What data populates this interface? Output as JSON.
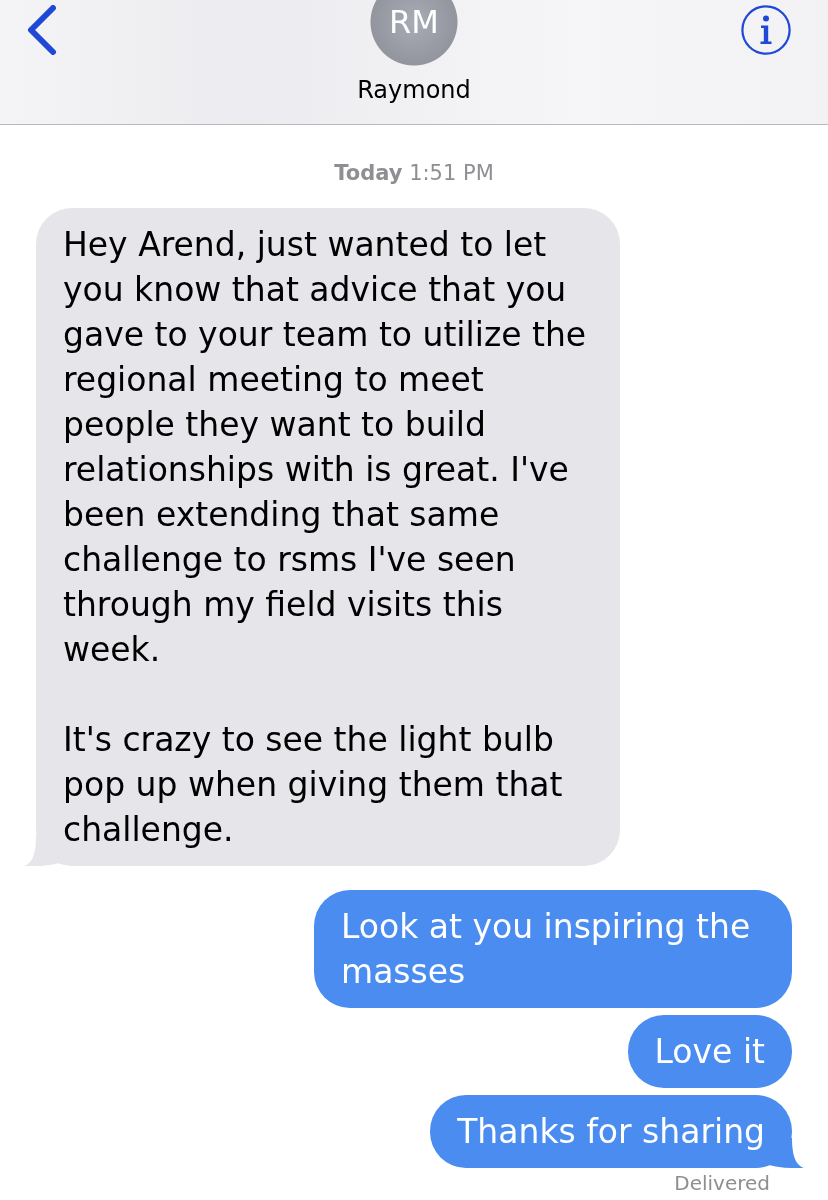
{
  "header": {
    "avatar_initials": "RM",
    "contact_name": "Raymond"
  },
  "timestamp": "**Today** 1:51 PM",
  "messages": [
    {
      "kind": "incoming",
      "tail": true,
      "paragraphs": [
        "Hey Arend, just wanted to let you know that advice that you gave to your team to utilize the regional meeting to meet people they want to build relationships with is great. I've been extending that same challenge to rsms I've seen through my field visits this week.",
        "It's crazy to see the light bulb pop up when giving them that challenge."
      ]
    },
    {
      "kind": "outgoing",
      "tail": false,
      "paragraphs": [
        "Look at you inspiring the masses"
      ]
    },
    {
      "kind": "outgoing",
      "tail": false,
      "paragraphs": [
        "Love it"
      ]
    },
    {
      "kind": "outgoing",
      "tail": true,
      "paragraphs": [
        "Thanks for sharing"
      ]
    }
  ],
  "status": "Delivered"
}
